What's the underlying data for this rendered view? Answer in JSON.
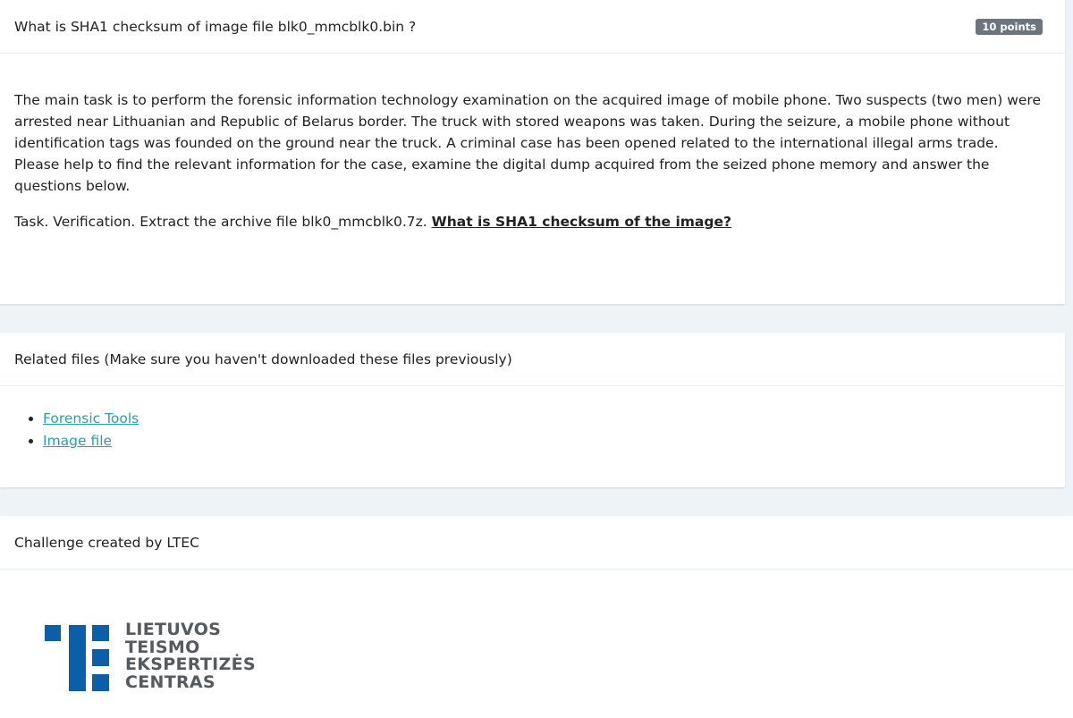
{
  "question": {
    "title": "What is SHA1 checksum of image file blk0_mmcblk0.bin ?",
    "points": "10 points"
  },
  "description": {
    "text": "The main task is to perform the forensic information technology examination on the acquired image of mobile phone. Two suspects (two men) were arrested near Lithuanian and Republic of Belarus border. The truck with stored weapons was taken. During the seizure, a mobile phone without identification tags was founded on the ground near the truck. A criminal case has been opened related to the international illegal arms trade. Please help to find the relevant information for the case, examine the digital dump acquired from the seized phone memory and answer the questions below.",
    "task_prefix": "Task. Verification. Extract the archive file blk0_mmcblk0.7z.",
    "task_question": "What is SHA1 checksum of the image?"
  },
  "related_files": {
    "header": "Related files (Make sure you haven't downloaded these files previously)",
    "items": [
      {
        "label": "Forensic Tools"
      },
      {
        "label": "Image file"
      }
    ]
  },
  "author": {
    "header": "Challenge created by LTEC",
    "logo_lines": [
      "LIETUVOS",
      "TEISMO",
      "EKSPERTIZĖS",
      "CENTRAS"
    ],
    "logo_color": "#0a5fa8"
  },
  "colors": {
    "link": "#2a9fb0",
    "badge": "#6c757d",
    "background": "#edf3f7"
  }
}
